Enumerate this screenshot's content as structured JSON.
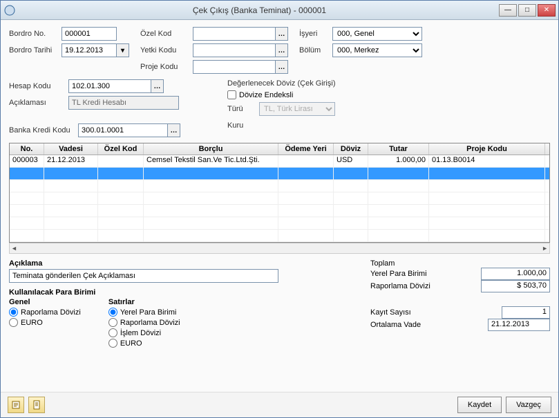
{
  "title": "Çek Çıkış (Banka Teminat) - 000001",
  "header": {
    "bordro_no_lbl": "Bordro No.",
    "bordro_no": "000001",
    "bordro_tarihi_lbl": "Bordro Tarihi",
    "bordro_tarihi": "19.12.2013",
    "ozel_kod_lbl": "Özel Kod",
    "ozel_kod": "",
    "yetki_kodu_lbl": "Yetki Kodu",
    "yetki_kodu": "",
    "proje_kodu_lbl": "Proje Kodu",
    "proje_kodu": "",
    "isyeri_lbl": "İşyeri",
    "isyeri": "000, Genel",
    "bolum_lbl": "Bölüm",
    "bolum": "000, Merkez"
  },
  "account": {
    "hesap_kodu_lbl": "Hesap Kodu",
    "hesap_kodu": "102.01.300",
    "aciklamasi_lbl": "Açıklaması",
    "aciklamasi": "TL Kredi Hesabı",
    "banka_kredi_kodu_lbl": "Banka Kredi Kodu",
    "banka_kredi_kodu": "300.01.0001"
  },
  "doviz": {
    "section_lbl": "Değerlenecek Döviz (Çek Girişi)",
    "endeksli_lbl": "Dövize Endeksli",
    "turu_lbl": "Türü",
    "turu": "TL, Türk Lirası",
    "kuru_lbl": "Kuru",
    "kuru": ""
  },
  "grid": {
    "cols": {
      "no": "No.",
      "vadesi": "Vadesi",
      "ozel_kod": "Özel Kod",
      "borclu": "Borçlu",
      "odeme_yeri": "Ödeme Yeri",
      "doviz": "Döviz",
      "tutar": "Tutar",
      "proje_kodu": "Proje Kodu"
    },
    "rows": [
      {
        "no": "000003",
        "vadesi": "21.12.2013",
        "ozel_kod": "",
        "borclu": "Cemsel Tekstil San.Ve Tic.Ltd.Şti.",
        "odeme_yeri": "",
        "doviz": "USD",
        "tutar": "1.000,00",
        "proje_kodu": "01.13.B0014"
      }
    ]
  },
  "aciklama": {
    "lbl": "Açıklama",
    "val": "Teminata gönderilen Çek Açıklaması"
  },
  "para_birimi": {
    "section_lbl": "Kullanılacak Para Birimi",
    "genel_lbl": "Genel",
    "genel_options": [
      "Raporlama Dövizi",
      "EURO"
    ],
    "genel_selected": "Raporlama Dövizi",
    "satirlar_lbl": "Satırlar",
    "satirlar_options": [
      "Yerel Para Birimi",
      "Raporlama Dövizi",
      "İşlem Dövizi",
      "EURO"
    ],
    "satirlar_selected": "Yerel Para Birimi"
  },
  "totals": {
    "toplam_lbl": "Toplam",
    "yerel_lbl": "Yerel Para Birimi",
    "yerel_val": "1.000,00",
    "raporlama_lbl": "Raporlama Dövizi",
    "raporlama_val": "$ 503,70",
    "kayit_lbl": "Kayıt Sayısı",
    "kayit_val": "1",
    "ortalama_lbl": "Ortalama Vade",
    "ortalama_val": "21.12.2013"
  },
  "buttons": {
    "kaydet": "Kaydet",
    "vazgec": "Vazgeç"
  }
}
